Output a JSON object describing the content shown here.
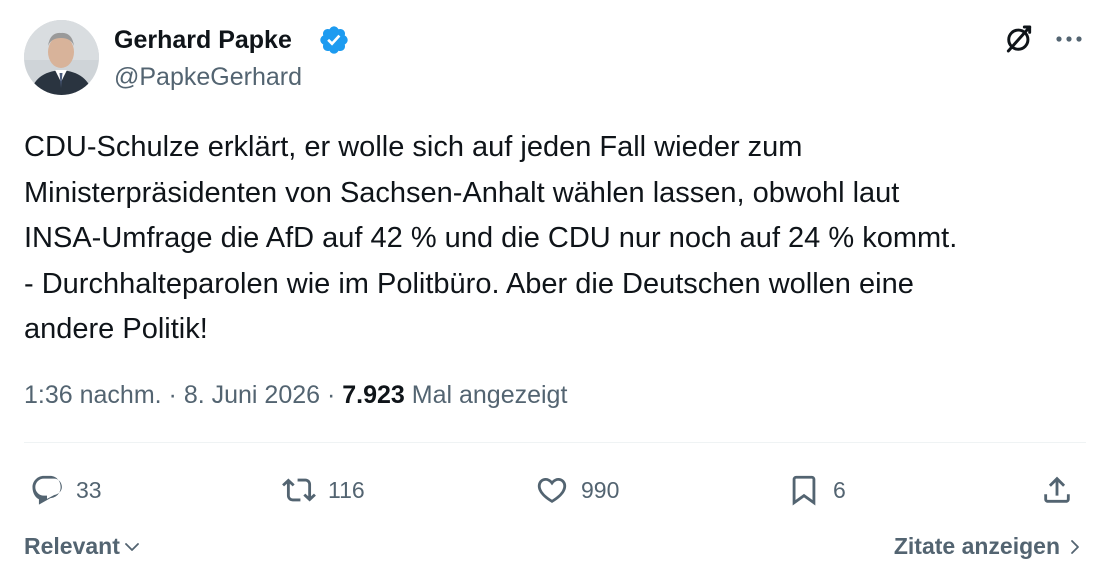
{
  "author": {
    "name": "Gerhard Papke",
    "handle": "@PapkeGerhard",
    "verified": true
  },
  "tweet": {
    "lines": [
      "CDU-Schulze erklärt, er wolle sich auf jeden Fall wieder zum",
      "Ministerpräsidenten von Sachsen-Anhalt wählen lassen, obwohl laut",
      "INSA-Umfrage die AfD auf 42 % und die CDU nur noch auf 24 % kommt.",
      "- Durchhalteparolen wie im Politbüro. Aber die Deutschen wollen eine",
      "andere Politik!"
    ]
  },
  "meta": {
    "time": "1:36 nachm.",
    "separator1": " · ",
    "date": "8. Juni 2026",
    "separator2": " · ",
    "views_count": "7.923",
    "views_label": " Mal angezeigt"
  },
  "actions": {
    "replies": "33",
    "reposts": "116",
    "likes": "990",
    "bookmarks": "6"
  },
  "footer": {
    "sort_label": "Relevant",
    "quotes_label": "Zitate anzeigen"
  },
  "colors": {
    "text": "#0f1419",
    "secondary": "#536471",
    "verified_blue": "#1d9bf0",
    "divider": "#eff3f4"
  },
  "icons": [
    "grok-icon",
    "more-icon",
    "verified-badge-icon",
    "reply-icon",
    "repost-icon",
    "like-icon",
    "bookmark-icon",
    "share-icon",
    "chevron-down-icon",
    "chevron-right-icon"
  ]
}
